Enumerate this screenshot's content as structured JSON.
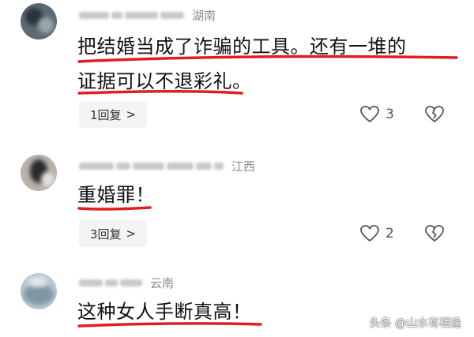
{
  "comments": [
    {
      "location": "湖南",
      "text_lines": [
        "把结婚当成了诈骗的工具。还有一堆的",
        "证据可以不退彩礼。"
      ],
      "reply_label": "1回复",
      "likes": "3"
    },
    {
      "location": "江西",
      "text_lines": [
        "重婚罪！"
      ],
      "reply_label": "3回复",
      "likes": "2"
    },
    {
      "location": "云南",
      "text_lines": [
        "这种女人手断真高！"
      ]
    }
  ],
  "watermark": "头条 @山水有相逢",
  "colors": {
    "underline": "#e02020",
    "icon": "#555555",
    "location": "#8a8a8a"
  }
}
